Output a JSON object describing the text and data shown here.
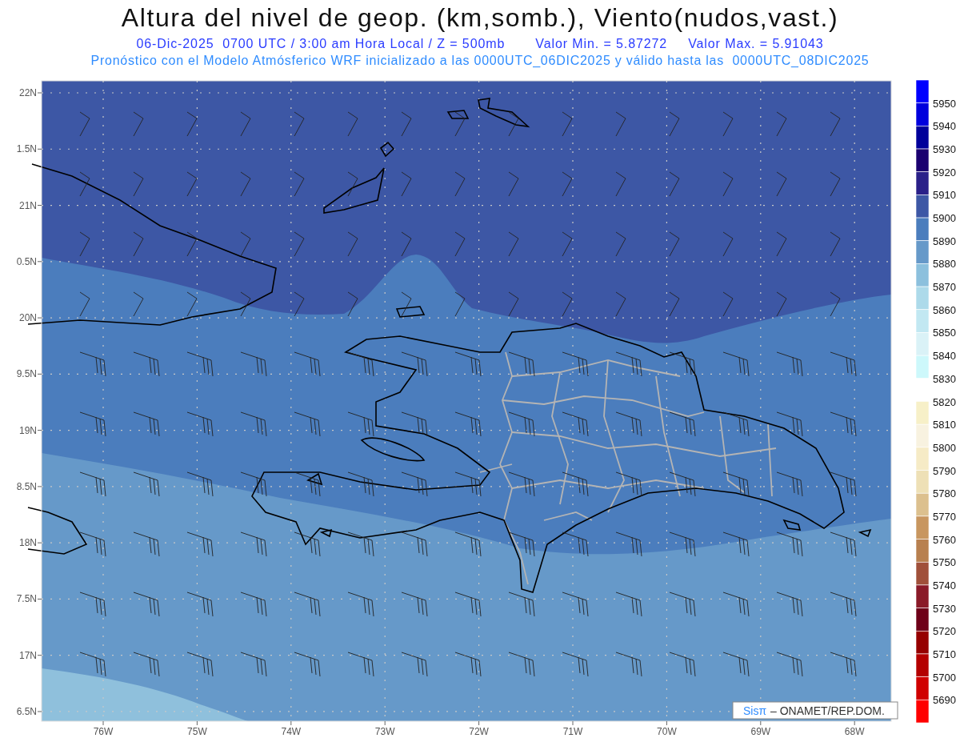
{
  "title": "Altura del nivel de geop. (km,somb.), Viento(nudos,vast.)",
  "subtitle": {
    "datetime": "06-Dic-2025  0700 UTC / 3:00 am Hora Local / Z = 500mb",
    "min": "Valor Min. = 5.87272",
    "max": "Valor Max. = 5.91043"
  },
  "description": "Pronóstico con el Modelo Atmósferico WRF inicializado a las 0000UTC_06DIC2025 y válido hasta las  0000UTC_08DIC2025",
  "map": {
    "lat_labels": [
      "22N",
      "1.5N",
      "21N",
      "0.5N",
      "20N",
      "9.5N",
      "19N",
      "8.5N",
      "18N",
      "7.5N",
      "17N",
      "6.5N"
    ],
    "lon_labels": [
      "76W",
      "75W",
      "74W",
      "73W",
      "72W",
      "71W",
      "70W",
      "69W",
      "68W"
    ]
  },
  "colorbar": {
    "segments": [
      {
        "color": "#0000ff"
      },
      {
        "color": "#0000dd"
      },
      {
        "color": "#00009a"
      },
      {
        "color": "#1a0070"
      },
      {
        "color": "#2a2089"
      },
      {
        "color": "#3d57a5"
      },
      {
        "color": "#4b7dbd"
      },
      {
        "color": "#6699c9"
      },
      {
        "color": "#8cc0dd"
      },
      {
        "color": "#addaea"
      },
      {
        "color": "#c2e8f2"
      },
      {
        "color": "#daf2f7"
      },
      {
        "color": "#cdf8fb"
      },
      {
        "color": "#ffffff"
      },
      {
        "color": "#f7f0c8"
      },
      {
        "color": "#f8f2e0"
      },
      {
        "color": "#f6ebc6"
      },
      {
        "color": "#eee0b6"
      },
      {
        "color": "#dcc08e"
      },
      {
        "color": "#c8965f"
      },
      {
        "color": "#b8804f"
      },
      {
        "color": "#a0503a"
      },
      {
        "color": "#8a1a28"
      },
      {
        "color": "#6e0018"
      },
      {
        "color": "#960000"
      },
      {
        "color": "#b40000"
      },
      {
        "color": "#d00000"
      },
      {
        "color": "#ff0000"
      }
    ],
    "labels": [
      "5950",
      "5940",
      "5930",
      "5920",
      "5910",
      "5900",
      "5890",
      "5880",
      "5870",
      "5860",
      "5850",
      "5840",
      "5830",
      "5820",
      "5810",
      "5800",
      "5790",
      "5780",
      "5770",
      "5760",
      "5750",
      "5740",
      "5730",
      "5720",
      "5710",
      "5700",
      "5690"
    ]
  },
  "credit": {
    "brand": "Sisπ",
    "text": "– ONAMET/REP.DOM."
  }
}
